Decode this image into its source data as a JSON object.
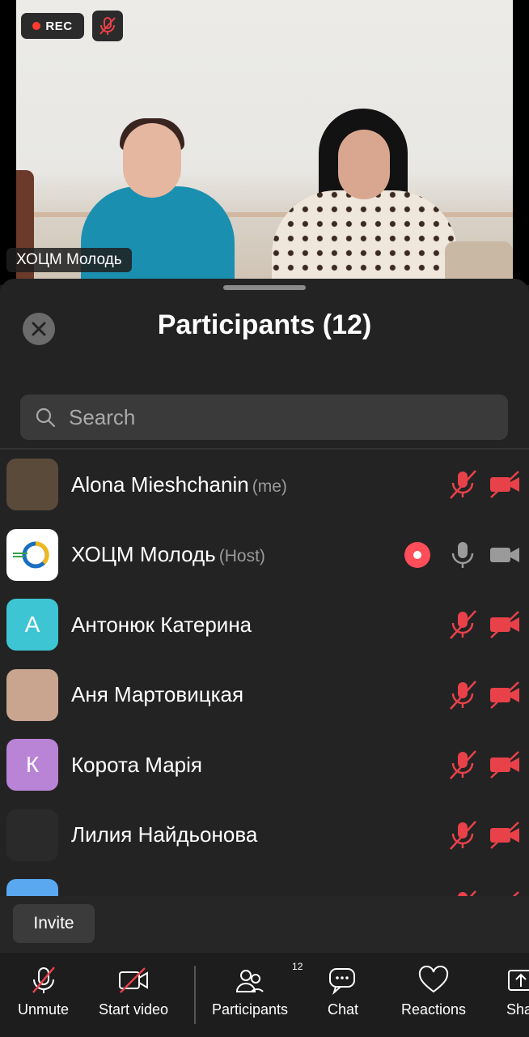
{
  "video": {
    "rec_label": "REC",
    "speaker_name": "ХОЦМ Молодь"
  },
  "panel": {
    "title": "Participants (12)",
    "search_placeholder": "Search"
  },
  "participants": [
    {
      "name": "Alona Mieshchanin",
      "tag": "(me)",
      "avatar_letter": "",
      "avatar_color": "#5a4a3a",
      "mic": "muted",
      "video": "off",
      "recording": false
    },
    {
      "name": "ХОЦМ Молодь",
      "tag": "(Host)",
      "avatar_letter": "",
      "avatar_color": "#ffffff",
      "mic": "on",
      "video": "on",
      "recording": true
    },
    {
      "name": "Антонюк Катерина",
      "tag": "",
      "avatar_letter": "А",
      "avatar_color": "#3ec5d4",
      "mic": "muted",
      "video": "off",
      "recording": false
    },
    {
      "name": "Аня Мартовицкая",
      "tag": "",
      "avatar_letter": "",
      "avatar_color": "#c9a58f",
      "mic": "muted",
      "video": "off",
      "recording": false
    },
    {
      "name": "Корота Марія",
      "tag": "",
      "avatar_letter": "К",
      "avatar_color": "#b983d6",
      "mic": "muted",
      "video": "off",
      "recording": false
    },
    {
      "name": "Лилия Найдьонова",
      "tag": "",
      "avatar_letter": "",
      "avatar_color": "#2a2a2a",
      "mic": "muted",
      "video": "off",
      "recording": false
    },
    {
      "name": "",
      "tag": "",
      "avatar_letter": "",
      "avatar_color": "#5aa8f0",
      "mic": "muted",
      "video": "off",
      "recording": false
    }
  ],
  "invite": {
    "label": "Invite"
  },
  "toolbar": {
    "unmute": "Unmute",
    "start_video": "Start video",
    "participants": "Participants",
    "participants_count": "12",
    "chat": "Chat",
    "reactions": "Reactions",
    "share": "Share"
  },
  "colors": {
    "muted_red": "#e8414a",
    "icon_gray": "#9a9a9a",
    "panel_bg": "#232323",
    "recording_red": "#ff4d5a"
  }
}
